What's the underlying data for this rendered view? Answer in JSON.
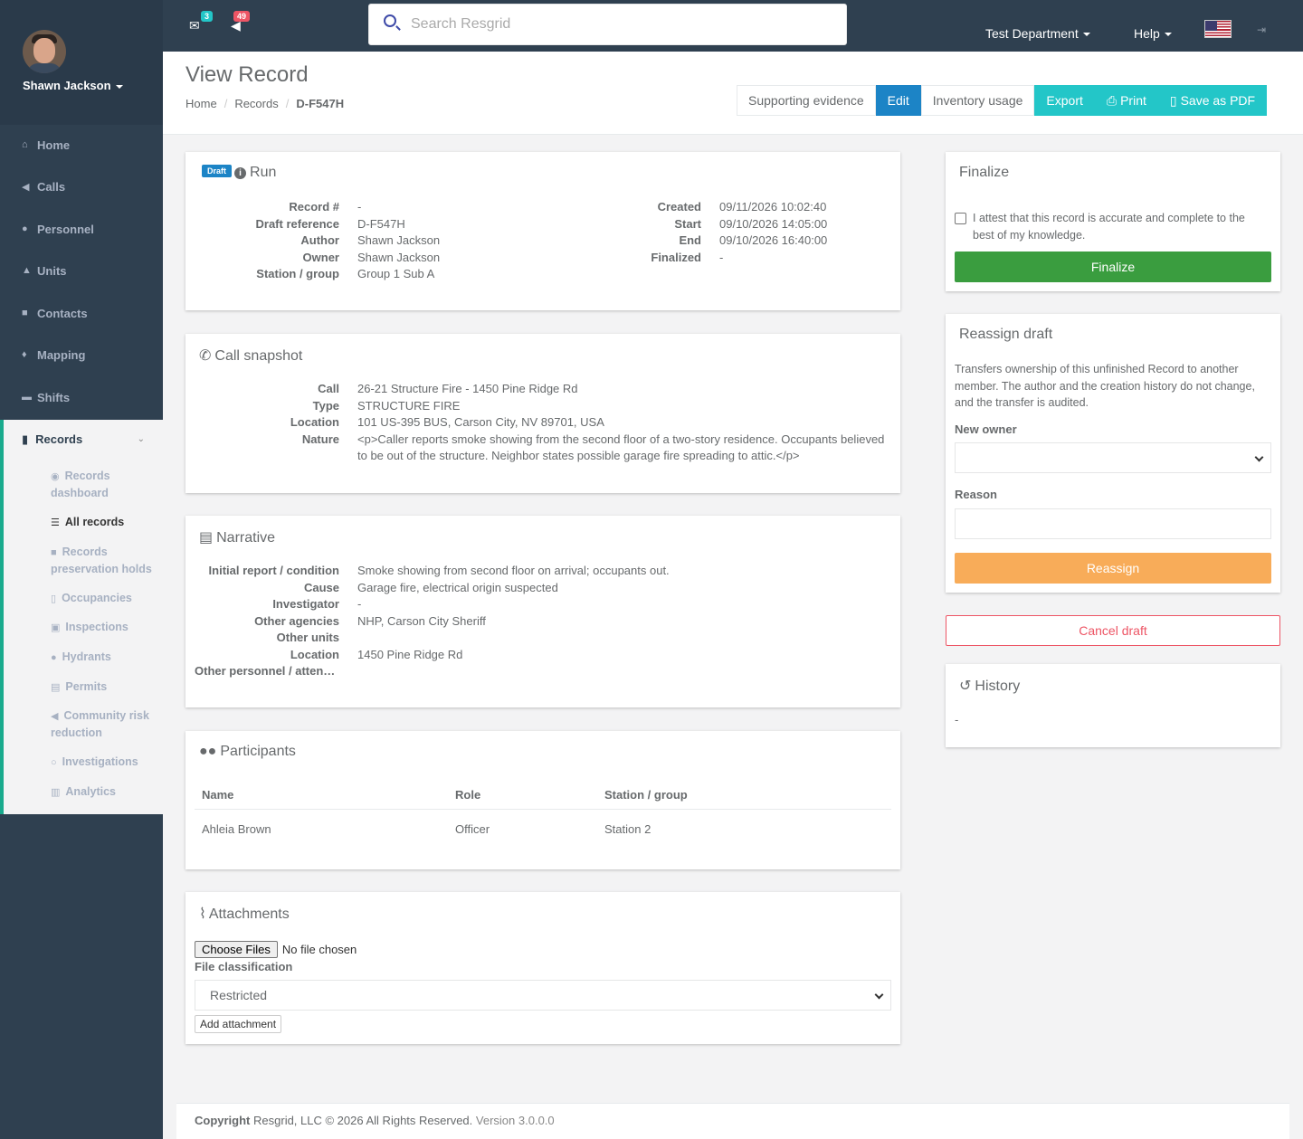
{
  "user": {
    "name": "Shawn Jackson"
  },
  "nav": {
    "items": [
      {
        "label": "Home",
        "icon": "home-icon"
      },
      {
        "label": "Calls",
        "icon": "bullhorn-icon"
      },
      {
        "label": "Personnel",
        "icon": "user-icon"
      },
      {
        "label": "Units",
        "icon": "truck-icon"
      },
      {
        "label": "Contacts",
        "icon": "address-book-icon"
      },
      {
        "label": "Mapping",
        "icon": "map-marker-icon"
      },
      {
        "label": "Shifts",
        "icon": "briefcase-icon"
      }
    ],
    "records": {
      "label": "Records",
      "sub": [
        {
          "label": "Records dashboard"
        },
        {
          "label": "All records"
        },
        {
          "label": "Records preservation holds"
        },
        {
          "label": "Occupancies"
        },
        {
          "label": "Inspections"
        },
        {
          "label": "Hydrants"
        },
        {
          "label": "Permits"
        },
        {
          "label": "Community risk reduction"
        },
        {
          "label": "Investigations"
        },
        {
          "label": "Analytics"
        }
      ]
    }
  },
  "topbar": {
    "messages_count": "3",
    "calls_count": "49",
    "search_placeholder": "Search Resgrid",
    "department": "Test Department",
    "help": "Help"
  },
  "page": {
    "title": "View Record",
    "breadcrumb": [
      "Home",
      "Records",
      "D-F547H"
    ],
    "actions": [
      "Supporting evidence",
      "Edit",
      "Inventory usage",
      "Export",
      "Print",
      "Save as PDF"
    ]
  },
  "run": {
    "badge": "Draft",
    "title": "Run",
    "left": [
      {
        "k": "Record #",
        "v": "-"
      },
      {
        "k": "Draft reference",
        "v": "D-F547H"
      },
      {
        "k": "Author",
        "v": "Shawn Jackson"
      },
      {
        "k": "Owner",
        "v": "Shawn Jackson"
      },
      {
        "k": "Station / group",
        "v": "Group 1 Sub A"
      }
    ],
    "right": [
      {
        "k": "Created",
        "v": "09/11/2026 10:02:40"
      },
      {
        "k": "Start",
        "v": "09/10/2026 14:05:00"
      },
      {
        "k": "End",
        "v": "09/10/2026 16:40:00"
      },
      {
        "k": "Finalized",
        "v": "-"
      }
    ]
  },
  "call": {
    "title": "Call snapshot",
    "rows": [
      {
        "k": "Call",
        "v": "26-21 Structure Fire - 1450 Pine Ridge Rd"
      },
      {
        "k": "Type",
        "v": "STRUCTURE FIRE"
      },
      {
        "k": "Location",
        "v": "101 US-395 BUS, Carson City, NV 89701, USA"
      },
      {
        "k": "Nature",
        "v": "<p>Caller reports smoke showing from the second floor of a two-story residence. Occupants believed to be out of the structure. Neighbor states possible garage fire spreading to attic.</p>"
      }
    ]
  },
  "narrative": {
    "title": "Narrative",
    "rows": [
      {
        "k": "Initial report / condition",
        "v": "Smoke showing from second floor on arrival; occupants out."
      },
      {
        "k": "Cause",
        "v": "Garage fire, electrical origin suspected"
      },
      {
        "k": "Investigator",
        "v": "-"
      },
      {
        "k": "Other agencies",
        "v": "NHP, Carson City Sheriff"
      },
      {
        "k": "Other units",
        "v": ""
      },
      {
        "k": "Location",
        "v": "1450 Pine Ridge Rd"
      },
      {
        "k": "Other personnel / atten…",
        "v": ""
      }
    ]
  },
  "participants": {
    "title": "Participants",
    "columns": [
      "Name",
      "Role",
      "Station / group"
    ],
    "rows": [
      [
        "Ahleia Brown",
        "Officer",
        "Station 2"
      ]
    ]
  },
  "attachments": {
    "title": "Attachments",
    "choose_label": "Choose Files",
    "no_file": "No file chosen",
    "classification_label": "File classification",
    "classification_value": "Restricted",
    "add_label": "Add attachment"
  },
  "finalize": {
    "title": "Finalize",
    "attest": "I attest that this record is accurate and complete to the best of my knowledge.",
    "button": "Finalize"
  },
  "reassign": {
    "title": "Reassign draft",
    "desc": "Transfers ownership of this unfinished Record to another member. The author and the creation history do not change, and the transfer is audited.",
    "owner_label": "New owner",
    "reason_label": "Reason",
    "button": "Reassign"
  },
  "cancel_label": "Cancel draft",
  "history": {
    "title": "History",
    "value": "-"
  },
  "footer": {
    "copyright": "Copyright",
    "company": "Resgrid, LLC © 2026 All Rights Reserved.",
    "version": "Version 3.0.0.0"
  },
  "colors": {
    "sidebar": "#2f4050",
    "primary": "#1c84c6",
    "info": "#23c6c8",
    "success": "#3a9d3f",
    "warning": "#f8ac59",
    "danger": "#ed5565"
  }
}
